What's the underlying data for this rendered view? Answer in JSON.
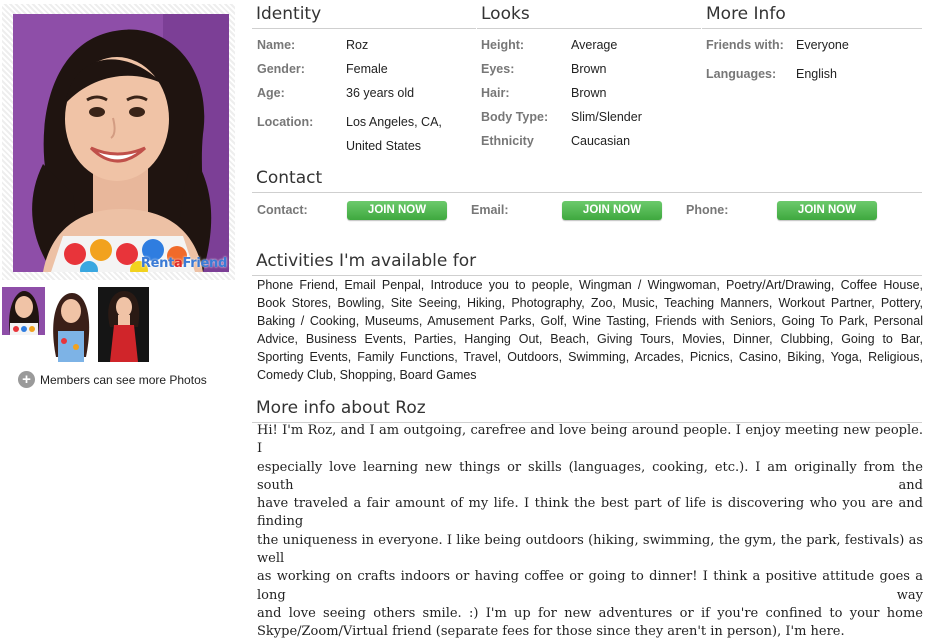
{
  "brand": {
    "prefix": "Rent",
    "o": "a",
    "suffix": "Friend"
  },
  "more_photos_label": "Members can see more Photos",
  "identity": {
    "title": "Identity",
    "name_label": "Name:",
    "name": "Roz",
    "gender_label": "Gender:",
    "gender": "Female",
    "age_label": "Age:",
    "age": "36 years old",
    "location_label": "Location:",
    "location_line1": "Los Angeles, CA,",
    "location_line2": "United States"
  },
  "looks": {
    "title": "Looks",
    "height_label": "Height:",
    "height": "Average",
    "eyes_label": "Eyes:",
    "eyes": "Brown",
    "hair_label": "Hair:",
    "hair": "Brown",
    "body_label": "Body Type:",
    "body": "Slim/Slender",
    "ethnicity_label": "Ethnicity",
    "ethnicity": "Caucasian"
  },
  "more_info": {
    "title": "More Info",
    "friends_label": "Friends with:",
    "friends": "Everyone",
    "languages_label": "Languages:",
    "languages": "English"
  },
  "contact": {
    "title": "Contact",
    "contact_label": "Contact:",
    "email_label": "Email:",
    "phone_label": "Phone:",
    "join_label": "JOIN NOW"
  },
  "activities": {
    "title": "Activities I'm available for",
    "lines": [
      "Phone Friend, Email Penpal, Introduce you to people, Wingman / Wingwoman, Poetry/Art/Drawing, Coffee House,",
      "Book Stores, Bowling, Site Seeing, Hiking, Photography, Zoo, Music, Teaching Manners, Workout Partner, Pottery,",
      "Baking / Cooking, Museums, Amusement Parks, Golf, Wine Tasting, Friends with Seniors, Going To Park, Personal",
      "Advice, Business Events, Parties, Hanging Out, Beach, Giving Tours, Movies, Dinner, Clubbing, Going to Bar,",
      "Sporting Events, Family Functions, Travel, Outdoors, Swimming, Arcades, Picnics, Casino, Biking, Yoga, Religious,",
      "Comedy Club, Shopping, Board Games"
    ]
  },
  "about": {
    "title": "More info about Roz",
    "lines": [
      "Hi! I'm Roz, and I am outgoing, carefree and love being around people. I enjoy meeting new people. I",
      "especially love learning new things or skills (languages, cooking, etc.). I am originally from the south and",
      "have traveled a fair amount of my life. I think the best part of life is discovering who you are and finding",
      "the uniqueness in everyone. I like being outdoors (hiking, swimming, the gym, the park, festivals) as well",
      "as working on crafts indoors or having coffee or going to dinner! I think a positive attitude goes a long way",
      "and love seeing others smile. :) I'm up for new adventures or if you're confined to your home",
      "Skype/Zoom/Virtual friend (separate fees for those since they aren't in person), I'm here."
    ]
  }
}
